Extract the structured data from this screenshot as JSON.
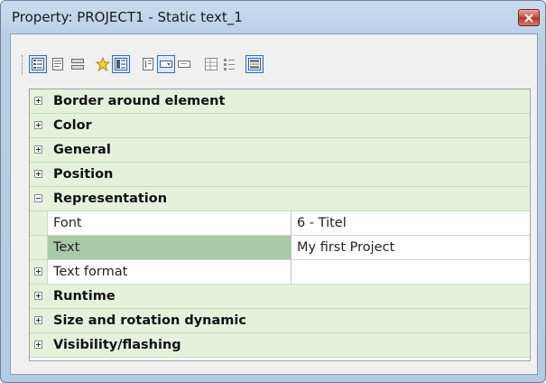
{
  "window": {
    "title": "Property: PROJECT1 - Static text_1"
  },
  "toolbar": {
    "buttons": [
      "categorized-view-icon",
      "alphabetic-view-icon",
      "object-list-icon",
      "favorites-star-icon",
      "property-pages-icon",
      "text-properties-icon",
      "dropdown-field-icon",
      "input-field-icon",
      "grid-properties-icon",
      "list-properties-icon",
      "object-palette-icon"
    ]
  },
  "grid": {
    "rows": [
      {
        "type": "category",
        "label": "Border around element",
        "expanded": false
      },
      {
        "type": "category",
        "label": "Color",
        "expanded": false
      },
      {
        "type": "category",
        "label": "General",
        "expanded": false
      },
      {
        "type": "category",
        "label": "Position",
        "expanded": false
      },
      {
        "type": "category",
        "label": "Representation",
        "expanded": true
      },
      {
        "type": "property",
        "name": "Font",
        "value": "6 - Titel"
      },
      {
        "type": "property",
        "name": "Text",
        "value": "My first Project",
        "selected": true
      },
      {
        "type": "property",
        "name": "Text format",
        "value": ""
      },
      {
        "type": "category",
        "label": "Runtime",
        "expanded": false
      },
      {
        "type": "category",
        "label": "Size and rotation dynamic",
        "expanded": false
      },
      {
        "type": "category",
        "label": "Visibility/flashing",
        "expanded": false
      }
    ]
  },
  "colors": {
    "category_bg": "#e6f1db",
    "selected_name_bg": "#a9c9a9",
    "title_bar": "#c9dcef",
    "close_button": "#c8483b"
  }
}
